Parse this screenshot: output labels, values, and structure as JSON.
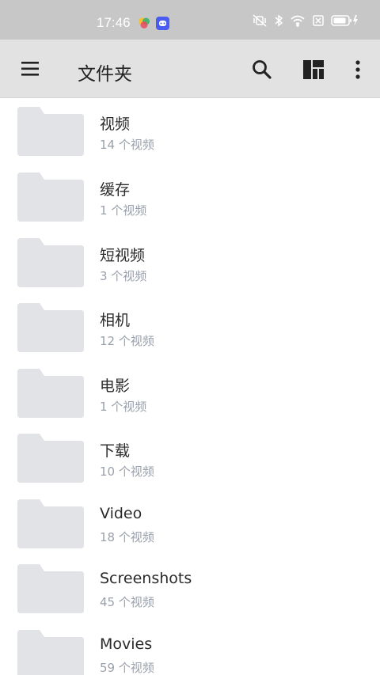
{
  "status_bar": {
    "time": "17:46",
    "icons": [
      "multicolor-app-icon",
      "chat-bot-app-icon",
      "mute-vibrate-icon",
      "bluetooth-icon",
      "wifi-icon",
      "no-sim-icon",
      "battery-charging-icon"
    ]
  },
  "app_bar": {
    "title": "文件夹",
    "menu_icon": "hamburger-menu-icon",
    "search_icon": "search-icon",
    "layout_icon": "grid-layout-icon",
    "more_icon": "more-vertical-icon"
  },
  "colors": {
    "status_bar_bg": "#c7c7c7",
    "app_bar_bg": "#e2e2e2",
    "folder_icon": "#e1e3e7",
    "count_text": "#9aa0ab"
  },
  "folders": [
    {
      "name": "视频",
      "count": "14 个视频"
    },
    {
      "name": "缓存",
      "count": "1 个视频"
    },
    {
      "name": "短视频",
      "count": "3 个视频"
    },
    {
      "name": "相机",
      "count": "12 个视频"
    },
    {
      "name": "电影",
      "count": "1 个视频"
    },
    {
      "name": "下载",
      "count": "10 个视频"
    },
    {
      "name": "Video",
      "count": "18 个视频"
    },
    {
      "name": "Screenshots",
      "count": "45 个视频"
    },
    {
      "name": "Movies",
      "count": "59 个视频"
    }
  ]
}
